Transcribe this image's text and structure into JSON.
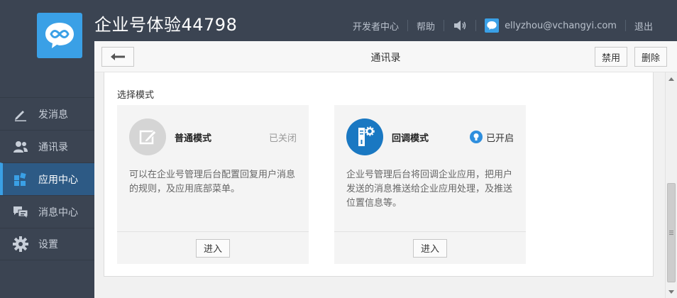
{
  "header": {
    "title": "企业号体验44798",
    "logo_icon": "chat-logo-icon",
    "nav": {
      "developer": "开发者中心",
      "help": "帮助",
      "sound_icon": "speaker-icon",
      "user_email": "ellyzhou@vchangyi.com",
      "logout": "退出"
    }
  },
  "sidebar": {
    "items": [
      {
        "label": "发消息",
        "icon": "pencil-icon"
      },
      {
        "label": "通讯录",
        "icon": "contacts-icon"
      },
      {
        "label": "应用中心",
        "icon": "apps-icon",
        "active": true
      },
      {
        "label": "消息中心",
        "icon": "messages-icon"
      },
      {
        "label": "设置",
        "icon": "gear-icon"
      }
    ]
  },
  "panel": {
    "title": "通讯录",
    "back_icon": "arrow-left-icon",
    "disable_label": "禁用",
    "delete_label": "删除",
    "section_label": "选择模式",
    "modes": [
      {
        "name": "普通模式",
        "status": "已关闭",
        "description": "可以在企业号管理后台配置回复用户消息的规则，及应用底部菜单。",
        "enter_label": "进入",
        "icon": "edit-icon"
      },
      {
        "name": "回调模式",
        "status": "已开启",
        "description": "企业号管理后台将回调企业应用，把用户发送的消息推送给企业应用处理，及推送位置信息等。",
        "enter_label": "进入",
        "icon": "server-gear-icon"
      }
    ]
  },
  "colors": {
    "background": "#3b4452",
    "accent": "#3aa0e6",
    "active_sidebar": "#2d5a85"
  }
}
